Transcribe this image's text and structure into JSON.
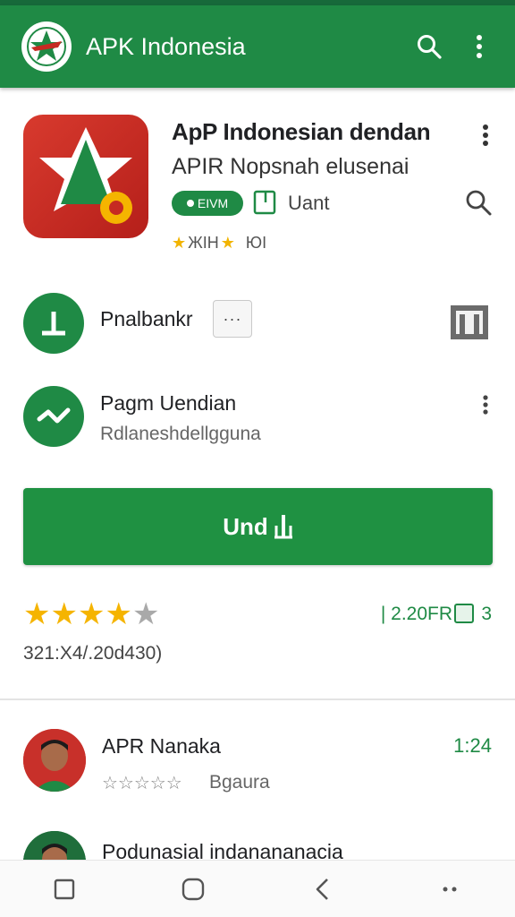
{
  "appbar": {
    "title": "APK Indonesia",
    "logo_icon": "star-flag-logo",
    "search_icon": "search-icon",
    "menu_icon": "more-vert-icon"
  },
  "hero": {
    "app_name": "ApP Indonesian dendan",
    "app_subtitle": "APIR Nopsnah elusenai",
    "badge_label": "EIVM",
    "tag_label": "Uant",
    "mini_rating_text": "ЖΙΗ",
    "mini_rating_count": "ЮΙ"
  },
  "rows": [
    {
      "label": "Pnalbankr",
      "chip": "···",
      "icon": "download-circle-icon",
      "side_icon": "gallery-icon"
    },
    {
      "label": "Pagm Uendian",
      "sub": "Rdlaneshdellgguna",
      "icon": "trend-circle-icon"
    }
  ],
  "install": {
    "label": "Und"
  },
  "rating": {
    "filled": 4,
    "total": 5,
    "count_text": "| 2.20FR",
    "trailing": "3",
    "sub_text": "321:X4/.20d430)"
  },
  "reviews": [
    {
      "name": "APR Nanaka",
      "time": "1:24",
      "stars_text": "☆☆☆☆☆",
      "sub": "Bgaura"
    },
    {
      "name": "Podunasial indanananacia"
    }
  ],
  "colors": {
    "primary": "#1f8a45",
    "accent_star": "#f5b400",
    "icon_red": "#c62a22"
  }
}
